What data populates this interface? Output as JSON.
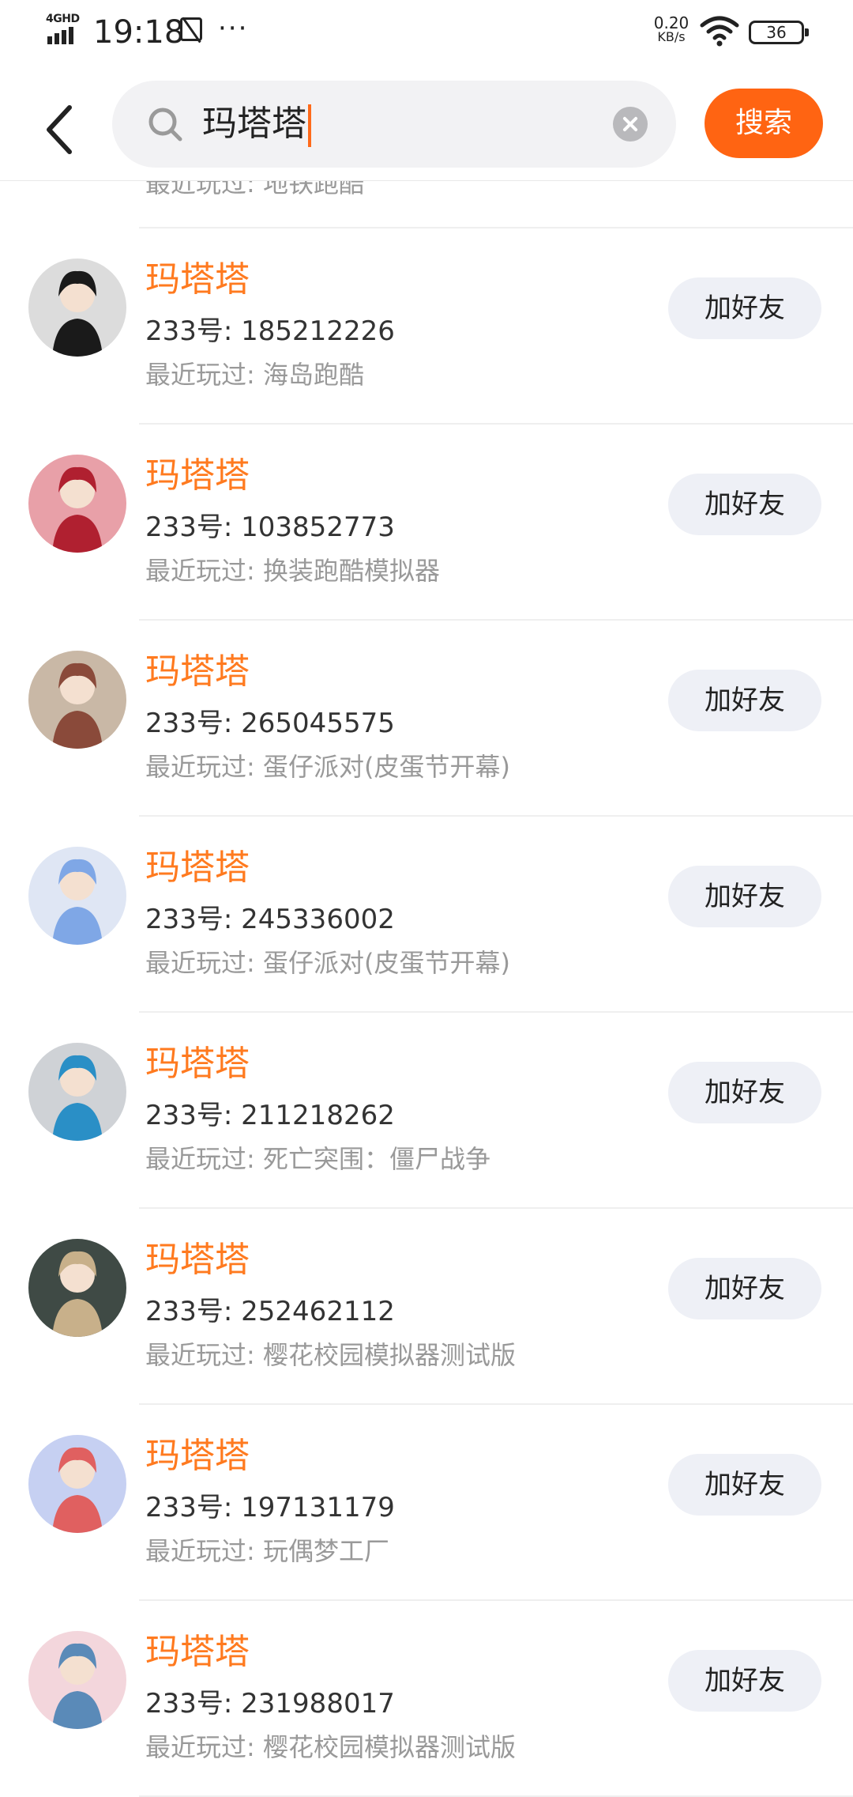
{
  "status_bar": {
    "network": "4GHD",
    "time": "19:18",
    "more": "···",
    "speed_value": "0.20",
    "speed_unit": "KB/s",
    "battery": "36"
  },
  "header": {
    "search_value": "玛塔塔",
    "search_button": "搜索"
  },
  "partial_row_text": "最近玩过: 地铁跑酷",
  "add_button_label": "加好友",
  "results": [
    {
      "name": "玛塔塔",
      "id_text": "233号: 185212226",
      "recent": "最近玩过: 海岛跑酷",
      "avatar_color": "#dcdcdc",
      "avatar_accent": "#1a1a1a"
    },
    {
      "name": "玛塔塔",
      "id_text": "233号: 103852773",
      "recent": "最近玩过: 换装跑酷模拟器",
      "avatar_color": "#e8a0a8",
      "avatar_accent": "#b02030"
    },
    {
      "name": "玛塔塔",
      "id_text": "233号: 265045575",
      "recent": "最近玩过: 蛋仔派对(皮蛋节开幕)",
      "avatar_color": "#c9b8a6",
      "avatar_accent": "#8a4a3a"
    },
    {
      "name": "玛塔塔",
      "id_text": "233号: 245336002",
      "recent": "最近玩过: 蛋仔派对(皮蛋节开幕)",
      "avatar_color": "#dfe6f4",
      "avatar_accent": "#7fa7e6"
    },
    {
      "name": "玛塔塔",
      "id_text": "233号: 211218262",
      "recent": "最近玩过: 死亡突围：僵尸战争",
      "avatar_color": "#cfd2d6",
      "avatar_accent": "#2a8fc6"
    },
    {
      "name": "玛塔塔",
      "id_text": "233号: 252462112",
      "recent": "最近玩过: 樱花校园模拟器测试版",
      "avatar_color": "#3f4a45",
      "avatar_accent": "#c8b08a"
    },
    {
      "name": "玛塔塔",
      "id_text": "233号: 197131179",
      "recent": "最近玩过: 玩偶梦工厂",
      "avatar_color": "#c6d0f2",
      "avatar_accent": "#e06060"
    },
    {
      "name": "玛塔塔",
      "id_text": "233号: 231988017",
      "recent": "最近玩过: 樱花校园模拟器测试版",
      "avatar_color": "#f3d6dc",
      "avatar_accent": "#5a8ab8"
    }
  ]
}
